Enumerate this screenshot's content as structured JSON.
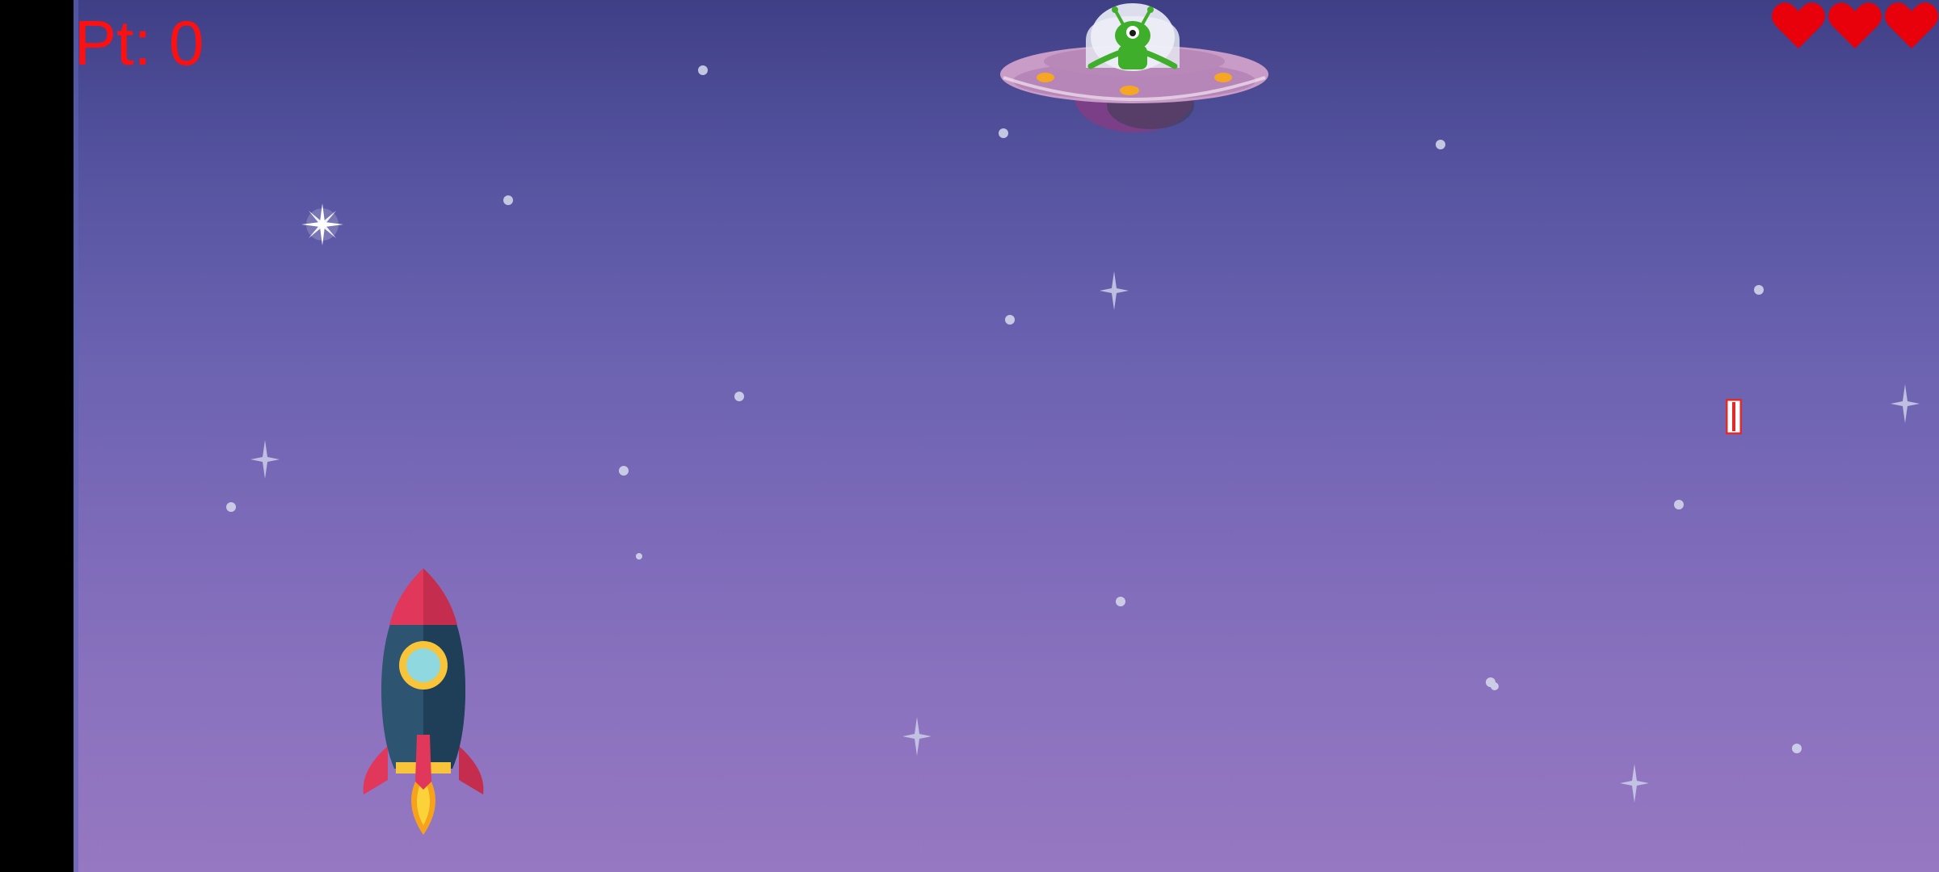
{
  "hud": {
    "score_text": "Pt: 0",
    "score_value": 0,
    "score_color": "#ff1010",
    "lives_remaining": 3,
    "heart_color": "#e8000b"
  },
  "sprites": {
    "player": "rocket",
    "enemy": "ufo-with-green-alien",
    "projectile": "red-laser-bolt"
  },
  "colors": {
    "sky_top": "#3f3f86",
    "sky_bottom": "#9677c1",
    "rocket_body": "#2d5470",
    "rocket_nose": "#e0375a",
    "flame": "#f7a21b",
    "ufo_saucer": "#c99bc7",
    "alien": "#3fae2a"
  }
}
